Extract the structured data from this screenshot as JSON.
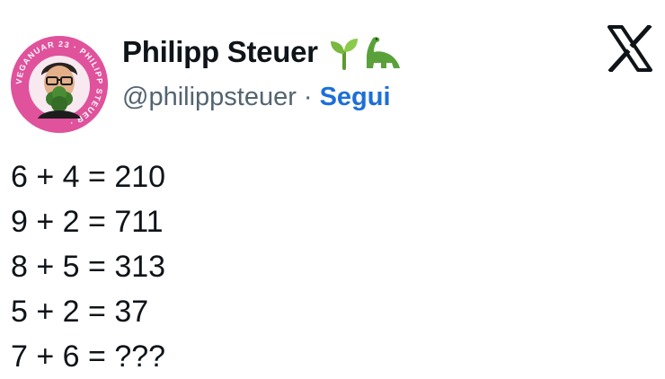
{
  "author": {
    "name": "Philipp Steuer",
    "handle": "@philippsteuer",
    "separator": "·",
    "follow_label": "Segui",
    "emojis": [
      "seedling-icon",
      "dinosaur-icon"
    ],
    "avatar_badge_text": "VEGANUAR 23 · PHILIPP STEUER ·",
    "avatar_ring_color": "#e0529c"
  },
  "platform_logo": "x-logo-icon",
  "tweet": {
    "lines": [
      "6 + 4 = 210",
      "9 + 2 = 711",
      "8 + 5 = 313",
      "5 + 2 = 37",
      "7 + 6 = ???"
    ]
  },
  "colors": {
    "text": "#0f1419",
    "secondary": "#536471",
    "link": "#1d6fd8"
  }
}
